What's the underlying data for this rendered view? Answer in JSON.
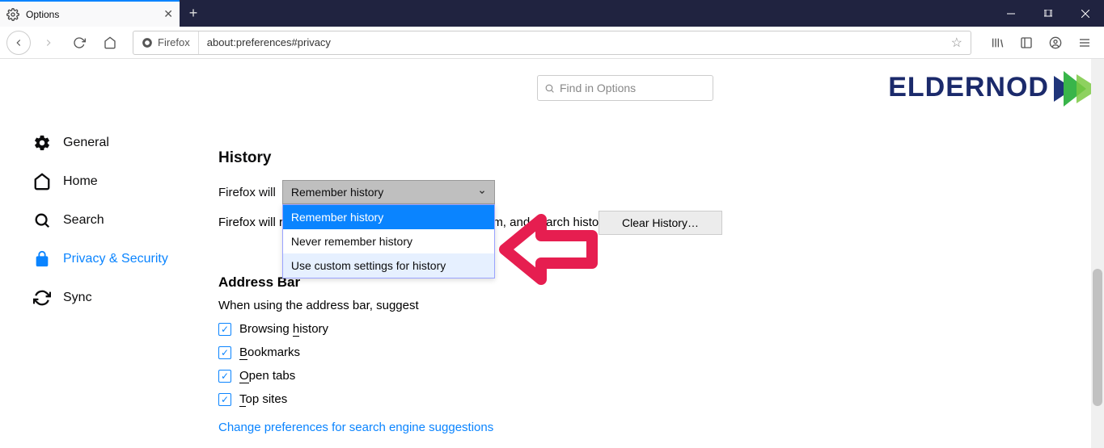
{
  "window": {
    "tab_title": "Options",
    "identity_label": "Firefox",
    "url": "about:preferences#privacy"
  },
  "search": {
    "placeholder": "Find in Options"
  },
  "sidebar": {
    "items": [
      {
        "label": "General"
      },
      {
        "label": "Home"
      },
      {
        "label": "Search"
      },
      {
        "label": "Privacy & Security"
      },
      {
        "label": "Sync"
      }
    ]
  },
  "history": {
    "heading": "History",
    "prefix": "Firefox will",
    "selected": "Remember history",
    "options": [
      "Remember history",
      "Never remember history",
      "Use custom settings for history"
    ],
    "description_prefix": "Firefox will r",
    "description_suffix": "m, and search history.",
    "clear_button": "Clear History…"
  },
  "addressbar": {
    "heading": "Address Bar",
    "subtext": "When using the address bar, suggest",
    "checks": [
      {
        "label_pre": "Browsing ",
        "label_u": "h",
        "label_post": "istory"
      },
      {
        "label_pre": "",
        "label_u": "B",
        "label_post": "ookmarks"
      },
      {
        "label_pre": "",
        "label_u": "O",
        "label_post": "pen tabs"
      },
      {
        "label_pre": "",
        "label_u": "T",
        "label_post": "op sites"
      }
    ],
    "link": "Change preferences for search engine suggestions"
  },
  "logo": {
    "text": "ELDERNOD"
  }
}
